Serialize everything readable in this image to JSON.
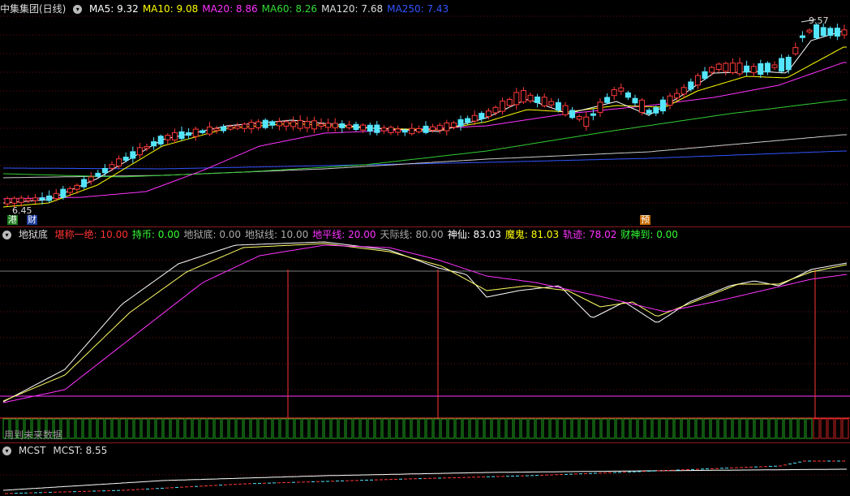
{
  "main": {
    "stock_name": "中集集团(日线)",
    "ma": [
      {
        "label": "MA5: 9.32",
        "color": "#ffffff"
      },
      {
        "label": "MA10: 9.08",
        "color": "#ffff00"
      },
      {
        "label": "MA20: 8.86",
        "color": "#ff33ff"
      },
      {
        "label": "MA60: 8.26",
        "color": "#33dd33"
      },
      {
        "label": "MA120: 7.68",
        "color": "#dddddd"
      },
      {
        "label": "MA250: 7.43",
        "color": "#3355ff"
      }
    ],
    "price_high_label": "9.57",
    "price_low_label": "6.45",
    "tags": {
      "left1": "港",
      "left2": "财",
      "right": "预"
    }
  },
  "indicator": {
    "name": "地狱底",
    "items": [
      {
        "label": "堪称一绝: 10.00",
        "color": "#ff3333"
      },
      {
        "label": "持币: 0.00",
        "color": "#33ff33"
      },
      {
        "label": "地狱底: 0.00",
        "color": "#aaaaaa"
      },
      {
        "label": "地狱线: 10.00",
        "color": "#aaaaaa"
      },
      {
        "label": "地平线: 20.00",
        "color": "#ff33ff"
      },
      {
        "label": "天际线: 80.00",
        "color": "#aaaaaa"
      },
      {
        "label": "神仙: 83.03",
        "color": "#ffffff"
      },
      {
        "label": "魔鬼: 81.03",
        "color": "#ffff00"
      },
      {
        "label": "轨迹: 78.02",
        "color": "#ff33ff"
      },
      {
        "label": "财神到: 0.00",
        "color": "#33ff33"
      }
    ],
    "watermark": "用到未来数据"
  },
  "mcst": {
    "name": "MCST",
    "value_label": "MCST: 8.55"
  }
}
